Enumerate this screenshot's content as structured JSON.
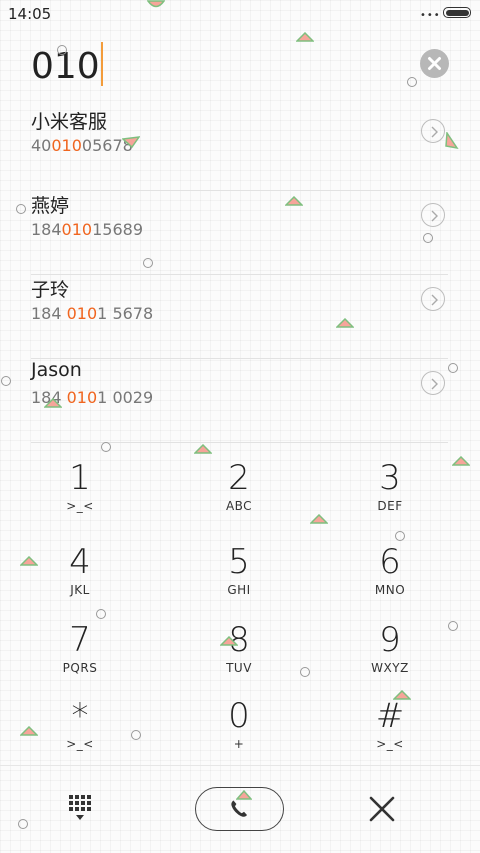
{
  "status_bar": {
    "time": "14:05"
  },
  "dial_input": {
    "value": "010"
  },
  "results": [
    {
      "name": "小米客服",
      "number_parts": [
        "40",
        "010",
        "05678"
      ]
    },
    {
      "name": "燕婷",
      "number_parts": [
        "184",
        "010",
        "15689"
      ]
    },
    {
      "name": "子玲",
      "number_parts": [
        "184 ",
        "010",
        "1 5678"
      ]
    },
    {
      "name": "Jason",
      "number_parts": [
        "184 ",
        "010",
        "1 0029"
      ]
    }
  ],
  "keypad": [
    {
      "digit": "1",
      "letters": ">_<"
    },
    {
      "digit": "2",
      "letters": "ABC"
    },
    {
      "digit": "3",
      "letters": "DEF"
    },
    {
      "digit": "4",
      "letters": "JKL"
    },
    {
      "digit": "5",
      "letters": "GHI"
    },
    {
      "digit": "6",
      "letters": "MNO"
    },
    {
      "digit": "7",
      "letters": "PQRS"
    },
    {
      "digit": "8",
      "letters": "TUV"
    },
    {
      "digit": "9",
      "letters": "WXYZ"
    },
    {
      "digit": "*",
      "letters": ">_<"
    },
    {
      "digit": "0",
      "letters": "+"
    },
    {
      "digit": "#",
      "letters": ">_<"
    }
  ],
  "bottom_bar": {
    "keypad_icon": "dialpad-grid-icon",
    "call_icon": "phone-handset-icon",
    "close_icon": "close-x-icon"
  },
  "colors": {
    "highlight": "#f0651f",
    "caret": "#f39c3a",
    "clear_button": "#b7b7b7"
  }
}
